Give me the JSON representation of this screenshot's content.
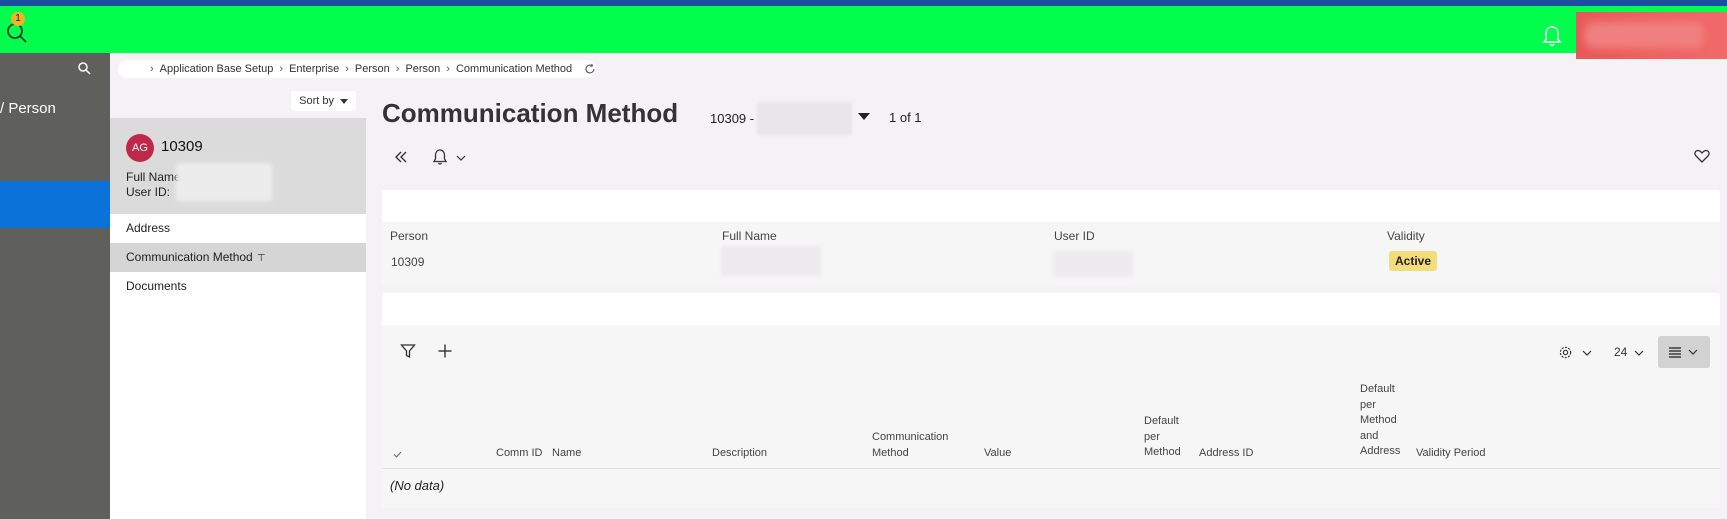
{
  "topbar": {
    "notification_count": "1",
    "icons": [
      "search-icon",
      "bell-icon"
    ],
    "colors": {
      "topbar": "#00ff4c",
      "top_strip": "#1c4ea0",
      "profile": "#ee6060"
    }
  },
  "nav": {
    "title": "/ Person",
    "active_color": "#0b72d9",
    "background": "#5f5f5b"
  },
  "breadcrumb": {
    "items": [
      "Application Base Setup",
      "Enterprise",
      "Person",
      "Person",
      "Communication Method"
    ]
  },
  "list": {
    "sort_label": "Sort by",
    "card": {
      "avatar_initials": "AG",
      "id": "10309",
      "full_name_label": "Full Name",
      "user_id_label": "User ID:"
    },
    "menu": [
      {
        "label": "Address"
      },
      {
        "label": "Communication Method"
      },
      {
        "label": "Documents"
      }
    ]
  },
  "header": {
    "title": "Communication Method",
    "record_id": "10309 -",
    "record_count": "1 of 1"
  },
  "person_card": {
    "fields": [
      {
        "label": "Person",
        "value": "10309"
      },
      {
        "label": "Full Name",
        "value": ""
      },
      {
        "label": "User ID",
        "value": ""
      },
      {
        "label": "Validity",
        "value": "Active"
      }
    ],
    "validity_color": "#f3dc7a"
  },
  "grid": {
    "page_size": "24",
    "columns": [
      "Comm ID",
      "Name",
      "Description",
      "Communication Method",
      "Value",
      "Default per Method",
      "Address ID",
      "Default per Method and Address",
      "Validity Period"
    ],
    "empty_text": "(No data)"
  }
}
